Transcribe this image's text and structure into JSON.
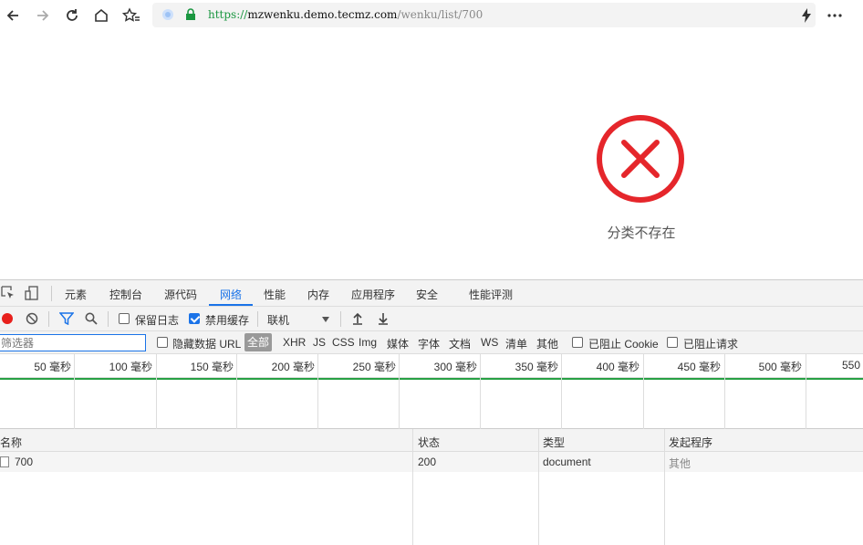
{
  "browser": {
    "url_scheme": "https://",
    "url_host": "mzwenku.demo.tecmz.com",
    "url_path": "/wenku/list/700"
  },
  "page": {
    "error_message": "分类不存在"
  },
  "devtools": {
    "tabs": [
      "元素",
      "控制台",
      "源代码",
      "网络",
      "性能",
      "内存",
      "应用程序",
      "安全",
      "性能评测"
    ],
    "active_tab": "网络",
    "toolbar": {
      "preserve_log": "保留日志",
      "disable_cache": "禁用缓存",
      "throttle": "联机"
    },
    "filter": {
      "placeholder": "筛选器",
      "hide_data_url": "隐藏数据 URL",
      "types": [
        "全部",
        "XHR",
        "JS",
        "CSS",
        "Img",
        "媒体",
        "字体",
        "文档",
        "WS",
        "清单",
        "其他"
      ],
      "blocked_cookies": "已阻止 Cookie",
      "blocked_requests": "已阻止请求"
    },
    "timeline_ticks": [
      "50 毫秒",
      "100 毫秒",
      "150 毫秒",
      "200 毫秒",
      "250 毫秒",
      "300 毫秒",
      "350 毫秒",
      "400 毫秒",
      "450 毫秒",
      "500 毫秒",
      "550"
    ],
    "table": {
      "headers": [
        "名称",
        "状态",
        "类型",
        "发起程序"
      ],
      "rows": [
        {
          "name": "700",
          "status": "200",
          "type": "document",
          "initiator": "其他"
        }
      ]
    }
  }
}
